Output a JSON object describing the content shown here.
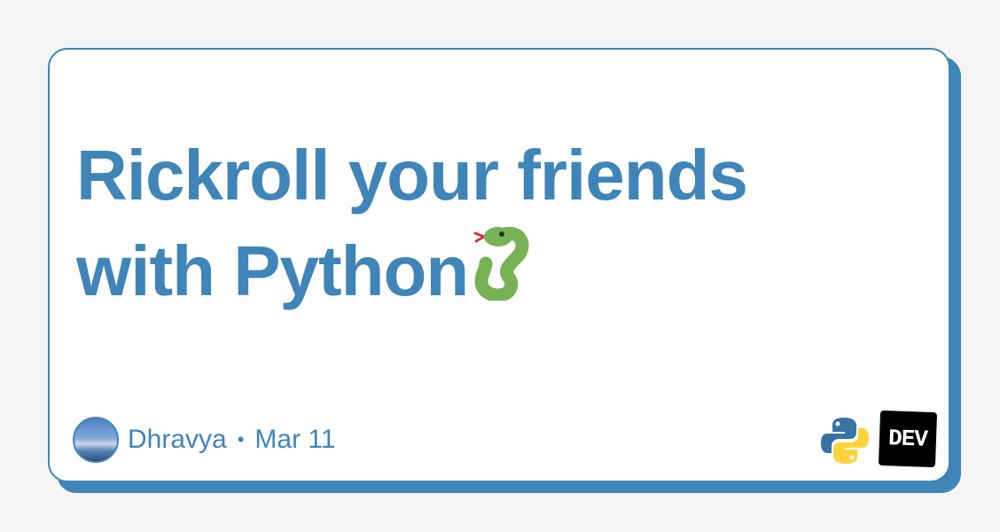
{
  "card": {
    "title_line1": "Rickroll your friends",
    "title_line2": "with Python",
    "title_emoji_icon": "snake-icon"
  },
  "author": {
    "name": "Dhravya",
    "separator": "•",
    "date": "Mar 11",
    "avatar_icon": "avatar-landscape"
  },
  "brand": {
    "tag_icon": "python-logo-icon",
    "site_logo": "DEV"
  },
  "colors": {
    "accent": "#3f85b8",
    "background": "#f5f5f5",
    "card": "#ffffff",
    "snake": "#77b255",
    "python_blue": "#3773a5",
    "python_yellow": "#ffd43b"
  }
}
